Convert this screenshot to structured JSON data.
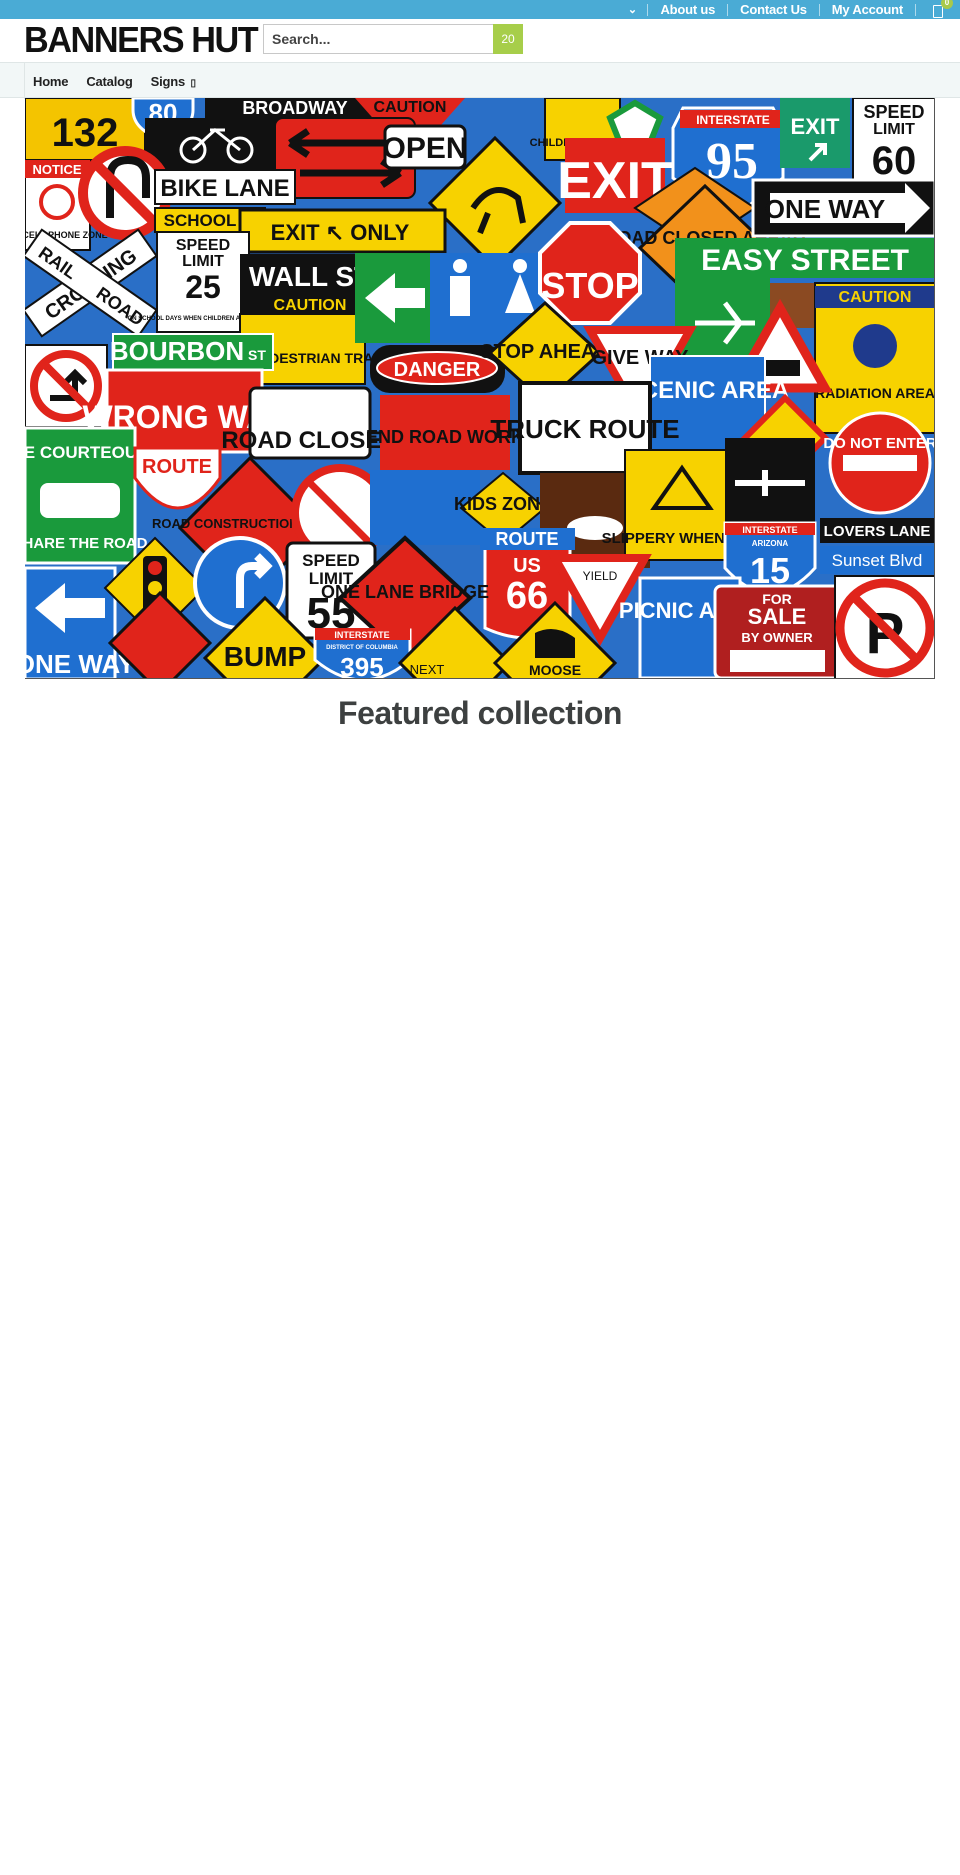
{
  "topbar": {
    "links": [
      {
        "label": "About us"
      },
      {
        "label": "Contact Us"
      },
      {
        "label": "My Account"
      }
    ],
    "cart_count": "0"
  },
  "header": {
    "logo": "BANNERS HUT",
    "search": {
      "placeholder": "Search...",
      "value": "",
      "button_label": "20"
    }
  },
  "nav": {
    "items": [
      {
        "label": "Home"
      },
      {
        "label": "Catalog"
      },
      {
        "label": "Signs"
      }
    ],
    "signs_caret": "▯"
  },
  "hero": {
    "signs": {
      "s132": "132",
      "s80": "80",
      "broadway": "BROADWAY",
      "caution_top": "CAUTION",
      "children": "CHILDREN AT PLAY",
      "speed60_l1": "SPEED",
      "speed60_l2": "LIMIT",
      "speed60_l3": "60",
      "notice": "NOTICE",
      "no_cell": "NO CELL PHONE ZONE",
      "bike_lane": "BIKE LANE",
      "open": "OPEN",
      "interstate": "INTERSTATE",
      "i95": "95",
      "exit_small": "EXIT",
      "school": "SCHOOL",
      "exit_big": "EXIT",
      "road_closed_ahead": "ROAD CLOSED AHEAD",
      "one_way_top": "ONE WAY",
      "rail": "RAIL",
      "road": "ROAD",
      "crossing": "CROSSING",
      "speed25_l1": "SPEED",
      "speed25_l2": "LIMIT",
      "speed25_l3": "25",
      "speed25_l4": "ON SCHOOL DAYS WHEN CHILDREN ARE PRESENT",
      "exit_only": "EXIT ↖ ONLY",
      "wall_st": "WALL ST",
      "caution_mid": "CAUTION",
      "heavy": "HEAVY PEDESTRIAN TRAFFIC",
      "stop": "STOP",
      "easy_street": "EASY STREET",
      "caution_right": "CAUTION",
      "radiation": "RADIATION AREA",
      "bourbon": "BOURBON",
      "bourbon_st": "ST",
      "danger": "DANGER",
      "stop_ahead": "STOP AHEAD",
      "give_way": "GIVE WAY",
      "wrong_way": "WRONG WAY",
      "truck_route": "TRUCK ROUTE",
      "scenic": "SCENIC AREA",
      "road_closed": "ROAD CLOSED",
      "end_road_work": "END ROAD WORK",
      "do_not_enter": "DO NOT ENTER",
      "be_courteous": "BE COURTEOUS",
      "share_the_road": "SHARE THE ROAD",
      "route": "ROUTE",
      "road_construction": "ROAD CONSTRUCTION AHEAD",
      "kids_zone": "KIDS ZONE",
      "slippery": "SLIPPERY WHEN WET",
      "lovers_lane": "LOVERS LANE",
      "interstate15_top": "INTERSTATE",
      "arizona": "ARIZONA",
      "i15": "15",
      "sunset": "Sunset Blvd",
      "speed55_l1": "SPEED",
      "speed55_l2": "LIMIT",
      "speed55_l3": "55",
      "route66_l1": "ROUTE",
      "route66_l2": "US",
      "route66_l3": "66",
      "one_lane_bridge": "ONE LANE BRIDGE",
      "yield": "YIELD",
      "picnic": "PICNIC AREA",
      "for_sale_l1": "FOR",
      "for_sale_l2": "SALE",
      "for_sale_l3": "BY OWNER",
      "one_way_bottom": "ONE WAY",
      "bump": "BUMP",
      "i395_top": "INTERSTATE",
      "i395_dc": "DISTRICT OF COLUMBIA",
      "i395": "395",
      "next": "NEXT",
      "moose": "MOOSE"
    }
  },
  "section": {
    "featured_title": "Featured collection"
  },
  "colors": {
    "topbar": "#4aabd5",
    "accent_green": "#a7ce4a",
    "nav_bg": "#f2f7f7"
  }
}
